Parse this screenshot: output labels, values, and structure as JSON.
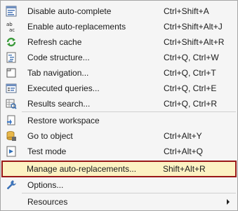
{
  "menu": {
    "items": [
      {
        "label": "Disable auto-complete",
        "shortcut": "Ctrl+Shift+A",
        "icon": "autocomplete-icon"
      },
      {
        "label": "Enable auto-replacements",
        "shortcut": "Ctrl+Shift+Alt+J",
        "icon": "ab-replace-icon"
      },
      {
        "label": "Refresh cache",
        "shortcut": "Ctrl+Shift+Alt+R",
        "icon": "refresh-icon"
      },
      {
        "label": "Code structure...",
        "shortcut": "Ctrl+Q, Ctrl+W",
        "icon": "code-structure-icon"
      },
      {
        "label": "Tab navigation...",
        "shortcut": "Ctrl+Q, Ctrl+T",
        "icon": "tab-navigation-icon"
      },
      {
        "label": "Executed queries...",
        "shortcut": "Ctrl+Q, Ctrl+E",
        "icon": "executed-queries-icon"
      },
      {
        "label": "Results search...",
        "shortcut": "Ctrl+Q, Ctrl+R",
        "icon": "results-search-icon"
      },
      {
        "label": "Restore workspace",
        "shortcut": "",
        "icon": "restore-workspace-icon"
      },
      {
        "label": "Go to object",
        "shortcut": "Ctrl+Alt+Y",
        "icon": "go-to-object-icon"
      },
      {
        "label": "Test mode",
        "shortcut": "Ctrl+Alt+Q",
        "icon": "test-mode-icon"
      },
      {
        "label": "Manage auto-replacements...",
        "shortcut": "Shift+Alt+R",
        "icon": ""
      },
      {
        "label": "Options...",
        "shortcut": "",
        "icon": "wrench-icon"
      },
      {
        "label": "Resources",
        "shortcut": "",
        "icon": ""
      }
    ],
    "highlight_color": "#fcf2c3",
    "highlight_border": "#991818"
  }
}
